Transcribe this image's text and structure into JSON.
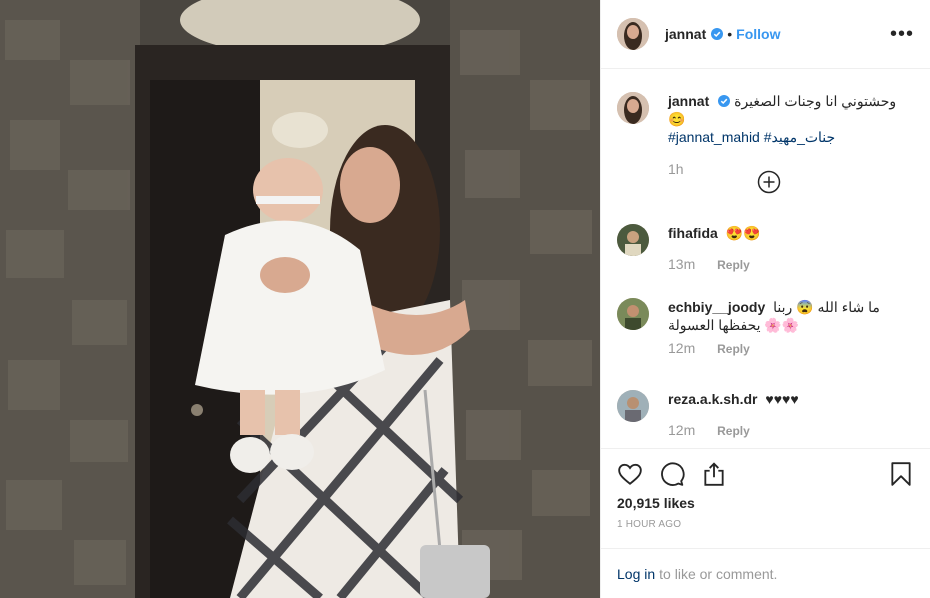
{
  "post": {
    "username": "jannat",
    "follow_label": "Follow",
    "dot": "•",
    "more_label": "•••"
  },
  "caption": {
    "username": "jannat",
    "text": "وحشتوني انا وجنات الصغيرة 😊",
    "hashtags": [
      "#jannat_mahid",
      "#جنات_مهيد"
    ],
    "time": "1h"
  },
  "comments": [
    {
      "username": "fihafida",
      "text": "😍😍",
      "time": "13m",
      "reply": "Reply"
    },
    {
      "username": "echbiy__joody",
      "text": "ما شاء الله 😨 ربنا يحفظها العسولة 🌸🌸",
      "time": "12m",
      "reply": "Reply"
    },
    {
      "username": "reza.a.k.sh.dr",
      "text": "♥♥♥♥",
      "time": "12m",
      "reply": "Reply"
    }
  ],
  "stats": {
    "likes": "20,915 likes",
    "posted": "1 HOUR AGO"
  },
  "login": {
    "link": "Log in",
    "rest": "to like or comment."
  },
  "colors": {
    "link": "#3897f0",
    "hashtag": "#003569",
    "muted": "#999999"
  }
}
